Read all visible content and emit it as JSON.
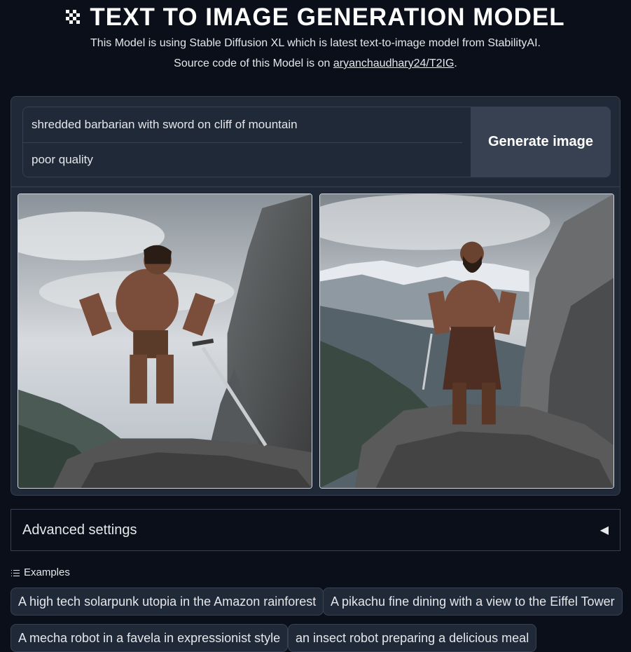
{
  "header": {
    "title": "TEXT TO IMAGE GENERATION MODEL",
    "subtitle": "This Model is using Stable Diffusion XL which is latest text-to-image model from StabilityAI.",
    "source_prefix": "Source code of this Model is on ",
    "source_link": "aryanchaudhary24/T2IG",
    "source_suffix": "."
  },
  "form": {
    "prompt_value": "shredded barbarian with sword on cliff of mountain",
    "negative_value": "poor quality",
    "generate_label": "Generate image"
  },
  "gallery": {
    "images": [
      "barbarian-on-cliff-1",
      "barbarian-on-cliff-2"
    ]
  },
  "advanced": {
    "label": "Advanced settings",
    "arrow": "◀"
  },
  "examples": {
    "label": "Examples",
    "items": [
      "A high tech solarpunk utopia in the Amazon rainforest",
      "A pikachu fine dining with a view to the Eiffel Tower",
      "A mecha robot in a favela in expressionist style",
      "an insect robot preparing a delicious meal"
    ]
  },
  "colors": {
    "background": "#0b0f19",
    "panel": "#1f2937",
    "border": "#374151",
    "button": "#374151"
  }
}
